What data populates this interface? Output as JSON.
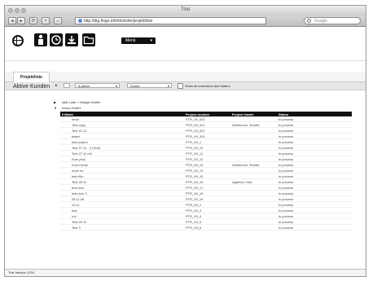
{
  "window": {
    "title": "Trixi"
  },
  "toolbar": {
    "back_label": "◂",
    "forward_label": "▸",
    "reload_label": "⟳",
    "add_label": "+",
    "home_label": "⌂",
    "url": "http://big.fingo.info/trixi/site/projektliste",
    "search_placeholder": "Google"
  },
  "app": {
    "menu_select": "Menü"
  },
  "tabs": {
    "active": "Projektliste"
  },
  "filters": {
    "select1": "",
    "select2": "is active",
    "select3": "Kunde",
    "checkbox_label": "Show all customers and folders"
  },
  "page": {
    "title": "Aktive Kunden"
  },
  "groups": [
    {
      "label": "AML Liste + Design GmbH"
    },
    {
      "label": "Krouz GmbH"
    }
  ],
  "table": {
    "headers": [
      "Markt",
      "Project number",
      "Project leader",
      "Status"
    ],
    "rows": [
      [
        "neue",
        "PTR_09_020",
        "",
        "in process"
      ],
      [
        "Test copy",
        "PTR_09_021",
        "Westhorne, Robert",
        "in process"
      ],
      [
        "Test 15.12",
        "PTR_09_022",
        "",
        "in process"
      ],
      [
        "tester",
        "PTR_09_024",
        "",
        "in process"
      ],
      [
        "test project",
        "PTR_09_1",
        "",
        "in process"
      ],
      [
        "Test 27.11 - 2 (Test)",
        "PTR_09_10",
        "",
        "in process"
      ],
      [
        "Test 27.11 mit",
        "PTR_09_11",
        "",
        "in process"
      ],
      [
        "Kurs plus",
        "PTR_09_12",
        "",
        "in process"
      ],
      [
        "Kurs minus",
        "PTR_09_13",
        "Westhorne, Robert",
        "in process"
      ],
      [
        "ohne es",
        "PTR_09_14",
        "",
        "in process"
      ],
      [
        "test Hilo",
        "PTR_09_15",
        "",
        "in process"
      ],
      [
        "Test 28.11",
        "PTR_09_16",
        "Agathen, Karl",
        "in process"
      ],
      [
        "test lxxiv",
        "PTR_09_17",
        "",
        "in process"
      ],
      [
        "test lxxiv 2",
        "PTR_09_18",
        "",
        "in process"
      ],
      [
        "28.11.06",
        "PTR_09_19",
        "",
        "in process"
      ],
      [
        "23.11",
        "PTR_09_2",
        "",
        "in process"
      ],
      [
        "test",
        "PTR_09_3",
        "",
        "in process"
      ],
      [
        "n/a",
        "PTR_09_4",
        "",
        "in process"
      ],
      [
        "Test 25.11",
        "PTR_09_5",
        "",
        "in process"
      ],
      [
        "Test 3",
        "PTR_09_6",
        "",
        "in process"
      ]
    ]
  },
  "status": {
    "text": "Trixi Version 1234"
  }
}
